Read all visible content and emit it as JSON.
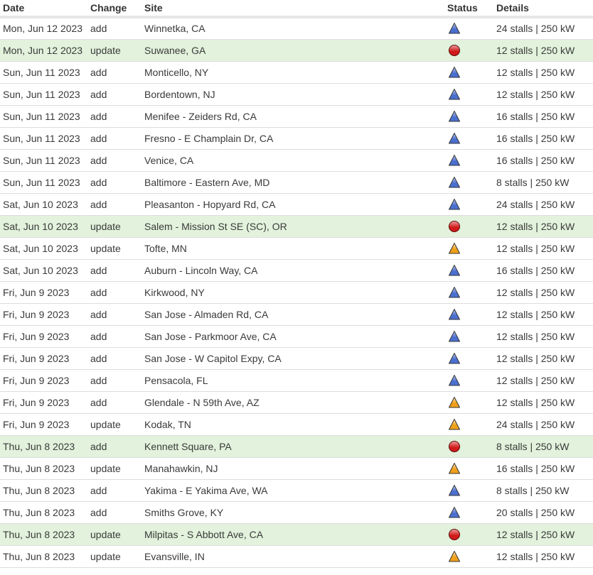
{
  "headers": {
    "date": "Date",
    "change": "Change",
    "site": "Site",
    "status": "Status",
    "details": "Details"
  },
  "status_icons": {
    "open": {
      "icon": "blue-triangle-icon",
      "color": "#4a6fd0"
    },
    "closed": {
      "icon": "red-circle-icon",
      "color": "#d11a1a"
    },
    "construction": {
      "icon": "orange-triangle-icon",
      "color": "#f0a018"
    }
  },
  "highlight_color": "#e2f2dc",
  "rows": [
    {
      "date": "Mon, Jun 12 2023",
      "change": "add",
      "site": "Winnetka, CA",
      "status": "open",
      "details": "24 stalls | 250 kW"
    },
    {
      "date": "Mon, Jun 12 2023",
      "change": "update",
      "site": "Suwanee, GA",
      "status": "closed",
      "details": "12 stalls | 250 kW"
    },
    {
      "date": "Sun, Jun 11 2023",
      "change": "add",
      "site": "Monticello, NY",
      "status": "open",
      "details": "12 stalls | 250 kW"
    },
    {
      "date": "Sun, Jun 11 2023",
      "change": "add",
      "site": "Bordentown, NJ",
      "status": "open",
      "details": "12 stalls | 250 kW"
    },
    {
      "date": "Sun, Jun 11 2023",
      "change": "add",
      "site": "Menifee - Zeiders Rd, CA",
      "status": "open",
      "details": "16 stalls | 250 kW"
    },
    {
      "date": "Sun, Jun 11 2023",
      "change": "add",
      "site": "Fresno - E Champlain Dr, CA",
      "status": "open",
      "details": "16 stalls | 250 kW"
    },
    {
      "date": "Sun, Jun 11 2023",
      "change": "add",
      "site": "Venice, CA",
      "status": "open",
      "details": "16 stalls | 250 kW"
    },
    {
      "date": "Sun, Jun 11 2023",
      "change": "add",
      "site": "Baltimore - Eastern Ave, MD",
      "status": "open",
      "details": "8 stalls | 250 kW"
    },
    {
      "date": "Sat, Jun 10 2023",
      "change": "add",
      "site": "Pleasanton - Hopyard Rd, CA",
      "status": "open",
      "details": "24 stalls | 250 kW"
    },
    {
      "date": "Sat, Jun 10 2023",
      "change": "update",
      "site": "Salem - Mission St SE (SC), OR",
      "status": "closed",
      "details": "12 stalls | 250 kW"
    },
    {
      "date": "Sat, Jun 10 2023",
      "change": "update",
      "site": "Tofte, MN",
      "status": "construction",
      "details": "12 stalls | 250 kW"
    },
    {
      "date": "Sat, Jun 10 2023",
      "change": "add",
      "site": "Auburn - Lincoln Way, CA",
      "status": "open",
      "details": "16 stalls | 250 kW"
    },
    {
      "date": "Fri, Jun 9 2023",
      "change": "add",
      "site": "Kirkwood, NY",
      "status": "open",
      "details": "12 stalls | 250 kW"
    },
    {
      "date": "Fri, Jun 9 2023",
      "change": "add",
      "site": "San Jose - Almaden Rd, CA",
      "status": "open",
      "details": "12 stalls | 250 kW"
    },
    {
      "date": "Fri, Jun 9 2023",
      "change": "add",
      "site": "San Jose - Parkmoor Ave, CA",
      "status": "open",
      "details": "12 stalls | 250 kW"
    },
    {
      "date": "Fri, Jun 9 2023",
      "change": "add",
      "site": "San Jose - W Capitol Expy, CA",
      "status": "open",
      "details": "12 stalls | 250 kW"
    },
    {
      "date": "Fri, Jun 9 2023",
      "change": "add",
      "site": "Pensacola, FL",
      "status": "open",
      "details": "12 stalls | 250 kW"
    },
    {
      "date": "Fri, Jun 9 2023",
      "change": "add",
      "site": "Glendale - N 59th Ave, AZ",
      "status": "construction",
      "details": "12 stalls | 250 kW"
    },
    {
      "date": "Fri, Jun 9 2023",
      "change": "update",
      "site": "Kodak, TN",
      "status": "construction",
      "details": "24 stalls | 250 kW"
    },
    {
      "date": "Thu, Jun 8 2023",
      "change": "add",
      "site": "Kennett Square, PA",
      "status": "closed",
      "details": "8 stalls | 250 kW"
    },
    {
      "date": "Thu, Jun 8 2023",
      "change": "update",
      "site": "Manahawkin, NJ",
      "status": "construction",
      "details": "16 stalls | 250 kW"
    },
    {
      "date": "Thu, Jun 8 2023",
      "change": "add",
      "site": "Yakima - E Yakima Ave, WA",
      "status": "open",
      "details": "8 stalls | 250 kW"
    },
    {
      "date": "Thu, Jun 8 2023",
      "change": "add",
      "site": "Smiths Grove, KY",
      "status": "open",
      "details": "20 stalls | 250 kW"
    },
    {
      "date": "Thu, Jun 8 2023",
      "change": "update",
      "site": "Milpitas - S Abbott Ave, CA",
      "status": "closed",
      "details": "12 stalls | 250 kW"
    },
    {
      "date": "Thu, Jun 8 2023",
      "change": "update",
      "site": "Evansville, IN",
      "status": "construction",
      "details": "12 stalls | 250 kW"
    }
  ]
}
